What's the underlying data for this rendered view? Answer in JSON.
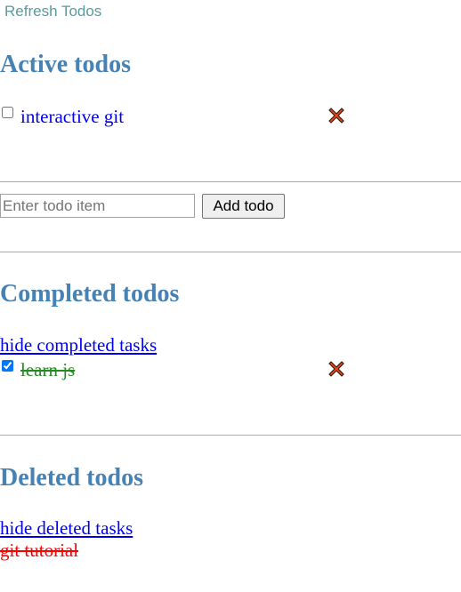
{
  "header": {
    "refresh_label": "Refresh Todos"
  },
  "active": {
    "title": "Active todos",
    "items": [
      {
        "label": "interactive git",
        "checked": false
      }
    ]
  },
  "form": {
    "placeholder": "Enter todo item",
    "value": "",
    "add_label": "Add todo"
  },
  "completed": {
    "title": "Completed todos",
    "toggle_label": "hide completed tasks",
    "items": [
      {
        "label": "learn js",
        "checked": true
      }
    ]
  },
  "deleted": {
    "title": "Deleted todos",
    "toggle_label": "hide deleted tasks",
    "items": [
      {
        "label": "git tutorial"
      }
    ]
  },
  "colors": {
    "heading": "#4682b4",
    "refresh_link": "#5a9aa0",
    "link": "#0000ee",
    "completed": "#228b22",
    "deleted": "#ff0000",
    "delete_icon_fill": "#e64a19"
  }
}
